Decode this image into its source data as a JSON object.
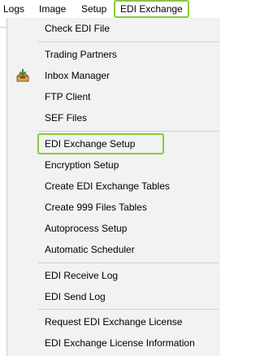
{
  "menubar": {
    "items": [
      {
        "label": "Logs"
      },
      {
        "label": "Image"
      },
      {
        "label": "Setup"
      },
      {
        "label": "EDI Exchange"
      }
    ]
  },
  "menu": {
    "items": [
      {
        "label": "Check EDI File"
      },
      {
        "label": "Trading Partners"
      },
      {
        "label": "Inbox Manager",
        "icon": "inbox-icon"
      },
      {
        "label": "FTP Client"
      },
      {
        "label": "SEF Files"
      },
      {
        "label": "EDI Exchange Setup"
      },
      {
        "label": "Encryption Setup"
      },
      {
        "label": "Create EDI Exchange Tables"
      },
      {
        "label": "Create 999 Files Tables"
      },
      {
        "label": "Autoprocess Setup"
      },
      {
        "label": "Automatic Scheduler"
      },
      {
        "label": "EDI Receive Log"
      },
      {
        "label": "EDI Send Log"
      },
      {
        "label": "Request EDI Exchange License"
      },
      {
        "label": "EDI Exchange License Information"
      }
    ]
  },
  "colors": {
    "highlight": "#8cc63f",
    "menu_bg": "#f2f2f2"
  }
}
